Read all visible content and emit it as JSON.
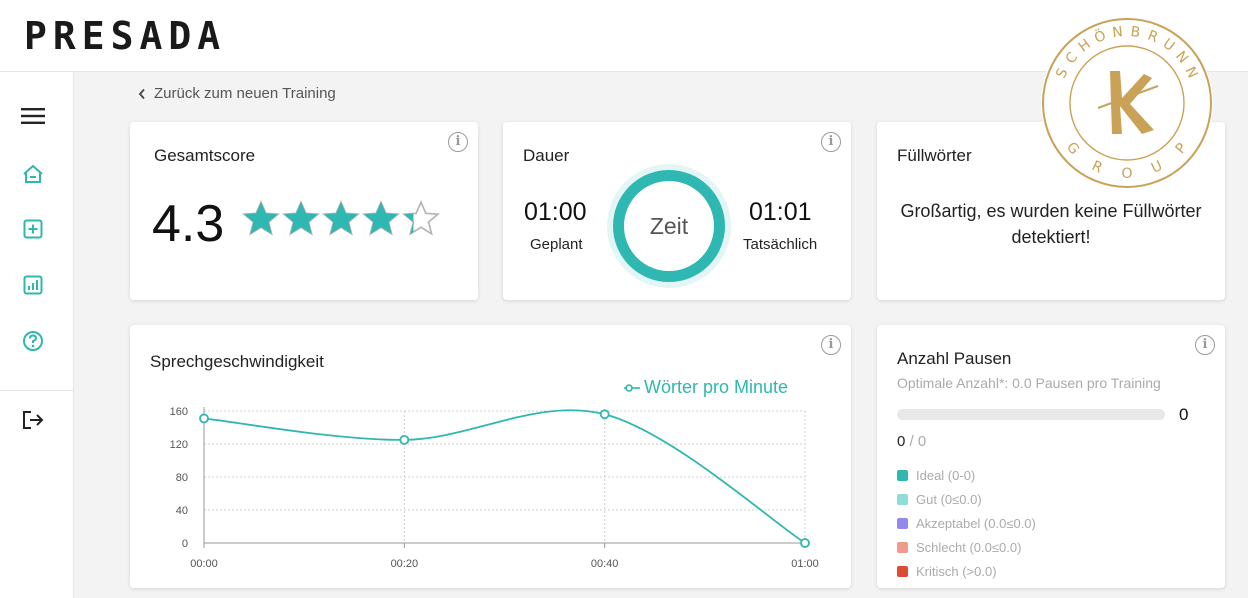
{
  "header": {
    "logo": "PRESADA"
  },
  "sidebar": {
    "items": [
      {
        "name": "menu",
        "icon": "menu-icon"
      },
      {
        "name": "home",
        "icon": "home-icon"
      },
      {
        "name": "new-training",
        "icon": "plus-square-icon"
      },
      {
        "name": "reports",
        "icon": "chart-icon"
      },
      {
        "name": "help",
        "icon": "help-icon"
      },
      {
        "name": "logout",
        "icon": "logout-icon"
      }
    ],
    "accent": "#2fb7b1"
  },
  "back": {
    "label": "Zurück zum neuen Training"
  },
  "score": {
    "title": "Gesamtscore",
    "value": "4.3",
    "stars_filled": 4.3,
    "stars_total": 5
  },
  "duration": {
    "title": "Dauer",
    "planned_value": "01:00",
    "planned_label": "Geplant",
    "center_label": "Zeit",
    "actual_value": "01:01",
    "actual_label": "Tatsächlich"
  },
  "filler": {
    "title": "Füllwörter",
    "message": "Großartig, es wurden keine Füllwörter detektiert!"
  },
  "speed": {
    "title": "Sprechgeschwindigkeit"
  },
  "chart_data": {
    "type": "line",
    "x": [
      "00:00",
      "00:20",
      "00:40",
      "01:00"
    ],
    "series": [
      {
        "name": "Wörter pro Minute",
        "values": [
          151,
          125,
          156,
          0
        ],
        "color": "#2fb7b1"
      }
    ],
    "y_ticks": [
      160,
      120,
      80,
      40,
      0
    ],
    "ylim": [
      0,
      160
    ],
    "grid": true,
    "legend": "top-right"
  },
  "pauses": {
    "title": "Anzahl Pausen",
    "subtitle": "Optimale Anzahl*: 0.0 Pausen pro Training",
    "count": "0",
    "progress": 0,
    "ratio_num": "0",
    "ratio_sep": "/",
    "ratio_den": "0",
    "legend": [
      {
        "label": "Ideal (0-0)",
        "color": "#2fb7b1"
      },
      {
        "label": "Gut (0≤0.0)",
        "color": "#8fdcd8"
      },
      {
        "label": "Akzeptabel (0.0≤0.0)",
        "color": "#9388ec"
      },
      {
        "label": "Schlecht (0.0≤0.0)",
        "color": "#f1998a"
      },
      {
        "label": "Kritisch (>0.0)",
        "color": "#dd4b35"
      }
    ]
  },
  "seal": {
    "text": "SCHÖNBRUNN GROUP",
    "color": "#c9a257"
  }
}
